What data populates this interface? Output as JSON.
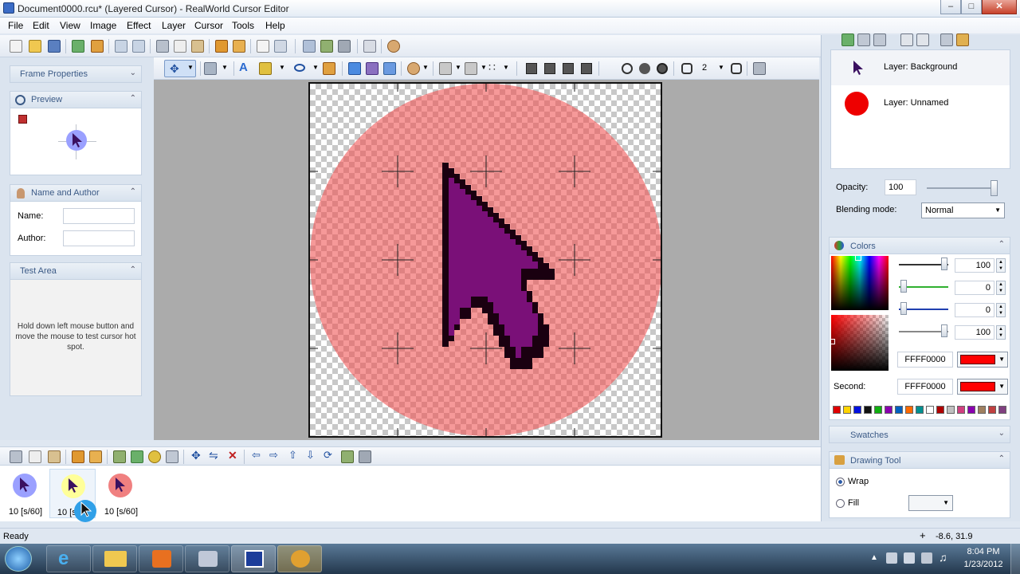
{
  "window": {
    "title": "Document0000.rcu* (Layered Cursor) - RealWorld Cursor Editor",
    "minimize": "–",
    "maximize": "□",
    "close": "✕"
  },
  "menu": [
    "File",
    "Edit",
    "View",
    "Image",
    "Effect",
    "Layer",
    "Cursor",
    "Tools",
    "Help"
  ],
  "left_panels": {
    "frame_properties": "Frame Properties",
    "preview": "Preview",
    "name_author": {
      "title": "Name and Author",
      "name_label": "Name:",
      "author_label": "Author:",
      "name_value": "",
      "author_value": ""
    },
    "test_area": {
      "title": "Test Area",
      "hint": "Hold down left mouse button and move the mouse to test cursor hot spot."
    }
  },
  "tool_toolbar": {
    "line_width": "2"
  },
  "layers": {
    "items": [
      {
        "name": "Layer: Background",
        "icon": "cursor-arrow-icon"
      },
      {
        "name": "Layer: Unnamed",
        "icon": "red-circle-icon"
      }
    ],
    "opacity_label": "Opacity:",
    "opacity_value": "100",
    "blending_label": "Blending mode:",
    "blending_value": "Normal"
  },
  "colors": {
    "title": "Colors",
    "values": [
      "100",
      "0",
      "0",
      "100"
    ],
    "primary_hex": "FFFF0000",
    "second_label": "Second:",
    "second_hex": "FFFF0000",
    "primary_color": "#ff0000",
    "swatches": [
      "#e00000",
      "#ffd400",
      "#0010e0",
      "#111111",
      "#10b010",
      "#8a00b0",
      "#0060c0",
      "#ff6a00",
      "#009090",
      "#ffffff",
      "#b00000",
      "#c0c0c0",
      "#d04080",
      "#8a00b0",
      "#a08060",
      "#c04040",
      "#804080"
    ]
  },
  "swatches_panel": {
    "title": "Swatches"
  },
  "drawing_tool": {
    "title": "Drawing Tool",
    "wrap_label": "Wrap",
    "fill_label": "Fill",
    "wrap_selected": true
  },
  "frames": [
    {
      "label": "10 [s/60]",
      "bg": "#9aa0ff"
    },
    {
      "label": "10 [s/60]",
      "bg": "#ffff99"
    },
    {
      "label": "10 [s/60]",
      "bg": "#f08080"
    }
  ],
  "status": {
    "text": "Ready",
    "coords": "-8.6, 31.9"
  },
  "taskbar": {
    "time": "8:04 PM",
    "date": "1/23/2012"
  }
}
